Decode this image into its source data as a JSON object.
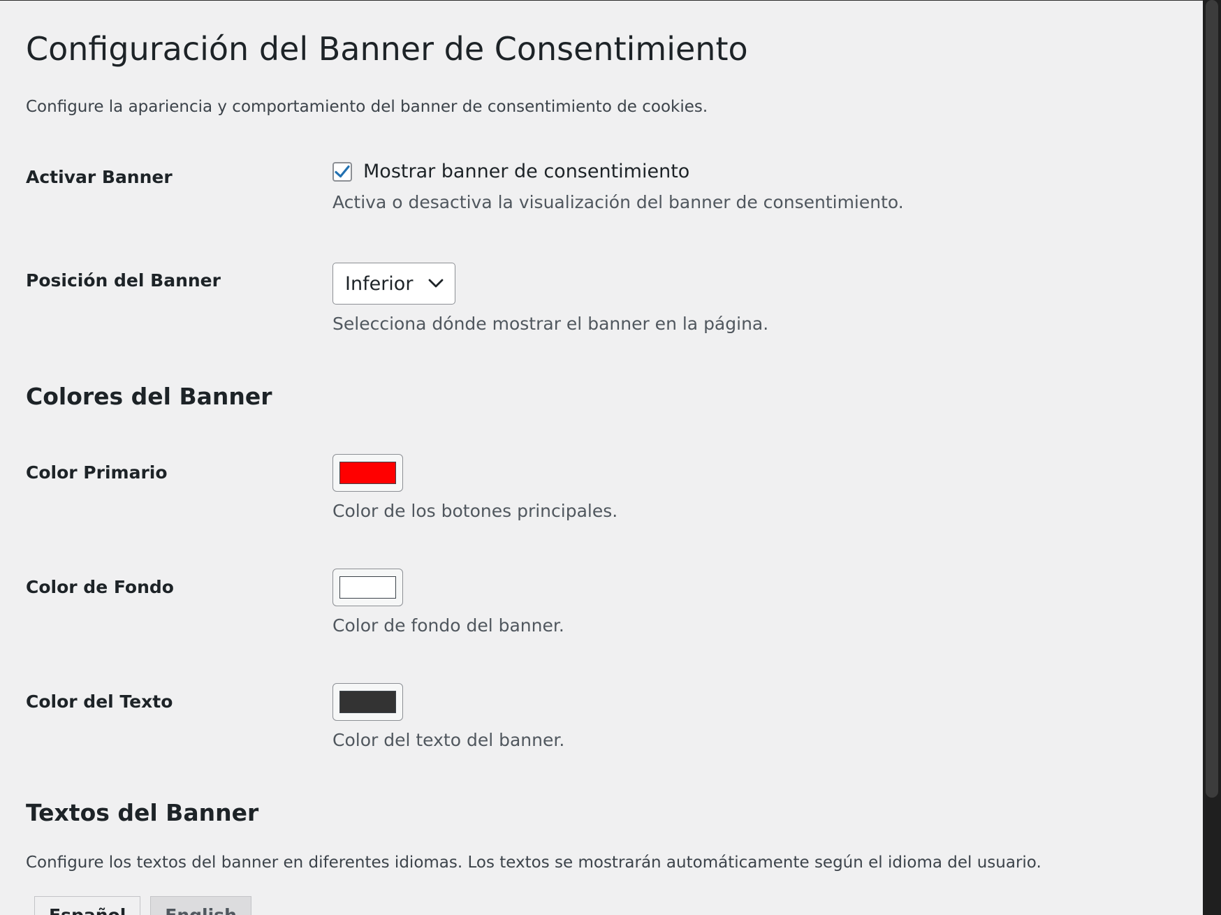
{
  "page": {
    "title": "Configuración del Banner de Consentimiento",
    "intro": "Configure la apariencia y comportamiento del banner de consentimiento de cookies."
  },
  "enable_banner": {
    "label": "Activar Banner",
    "checkbox_label": "Mostrar banner de consentimiento",
    "checked": true,
    "description": "Activa o desactiva la visualización del banner de consentimiento."
  },
  "position": {
    "label": "Posición del Banner",
    "selected": "Inferior",
    "description": "Selecciona dónde mostrar el banner en la página."
  },
  "colors_section": {
    "heading": "Colores del Banner",
    "primary": {
      "label": "Color Primario",
      "value": "#ff0000",
      "description": "Color de los botones principales."
    },
    "background": {
      "label": "Color de Fondo",
      "value": "#ffffff",
      "description": "Color de fondo del banner."
    },
    "text": {
      "label": "Color del Texto",
      "value": "#333333",
      "description": "Color del texto del banner."
    }
  },
  "texts_section": {
    "heading": "Textos del Banner",
    "description": "Configure los textos del banner en diferentes idiomas. Los textos se mostrarán automáticamente según el idioma del usuario.",
    "tabs": [
      {
        "label": "Español"
      },
      {
        "label": "English"
      }
    ]
  },
  "theme": {
    "checkbox_accent": "#2271b1",
    "page_background": "#f0f0f1"
  }
}
